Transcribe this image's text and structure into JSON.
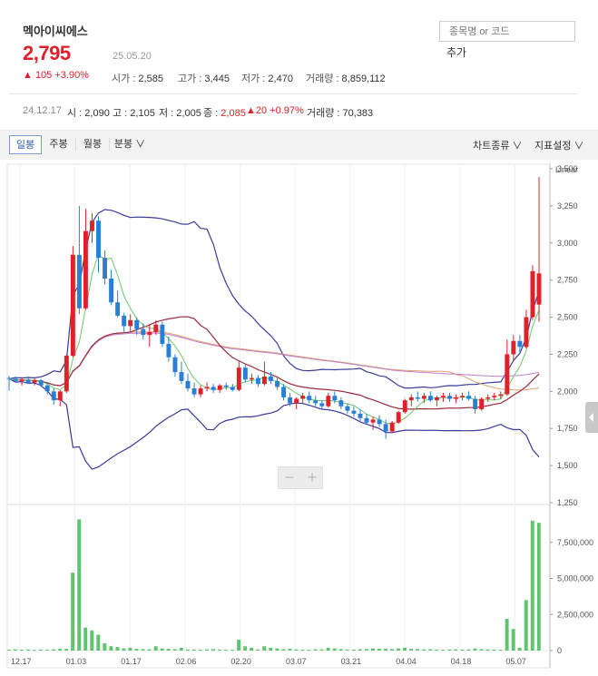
{
  "stock": {
    "name": "멕아이씨에스",
    "price": "2,795",
    "date": "25.05.20",
    "change": "▲ 105 +3.90%",
    "open_label": "시가 : ",
    "open": "2,585",
    "high_label": "고가 : ",
    "high": "3,445",
    "low_label": "저가 : ",
    "low": "2,470",
    "vol_label": "거래량 : ",
    "vol": "8,859,112"
  },
  "search": {
    "placeholder": "종목명 or 코드",
    "add_label": "추가"
  },
  "hover": {
    "date": "24.12.17",
    "open": "시 : 2,090",
    "high": "고 : 2,105",
    "low": "저 : 2,005",
    "close_label": "종 : ",
    "close": "2,085",
    "change": "▲20 +0.97%",
    "vol": "거래량 : 70,383"
  },
  "toolbar": {
    "tabs": [
      "일봉",
      "주봉",
      "월봉",
      "분봉 ∨"
    ],
    "chart_type": "차트종류 ∨",
    "indicator": "지표설정 ∨"
  },
  "colors": {
    "up": "#e0202a",
    "down": "#2a7fd4",
    "volume": "#5ec46e"
  },
  "chart_data": {
    "type": "candlestick",
    "scale_label": "Linear",
    "price_axis": {
      "min": 1250,
      "max": 3500,
      "ticks": [
        "3,500",
        "3,250",
        "3,000",
        "2,750",
        "2,500",
        "2,250",
        "2,000",
        "1,750",
        "1,500",
        "1,250"
      ]
    },
    "volume_axis": {
      "max": 10000000,
      "ticks": [
        "7,500,000",
        "5,000,000",
        "2,500,000",
        "0"
      ]
    },
    "x_ticks": [
      "12.17",
      "01.03",
      "01.17",
      "02.06",
      "02.20",
      "03.07",
      "03.21",
      "04.04",
      "04.18",
      "05.07"
    ],
    "candles_ohlc": [
      [
        2090,
        2105,
        2005,
        2085
      ],
      [
        2085,
        2100,
        2060,
        2070
      ],
      [
        2070,
        2095,
        2040,
        2080
      ],
      [
        2080,
        2100,
        2050,
        2060
      ],
      [
        2060,
        2090,
        2040,
        2075
      ],
      [
        2075,
        2085,
        2030,
        2040
      ],
      [
        2040,
        2060,
        1980,
        2000
      ],
      [
        2000,
        2020,
        1910,
        1940
      ],
      [
        1940,
        2010,
        1900,
        2000
      ],
      [
        2000,
        2250,
        1990,
        2240
      ],
      [
        2240,
        2980,
        2230,
        2920
      ],
      [
        2920,
        3250,
        2520,
        2560
      ],
      [
        2560,
        3230,
        2550,
        3080
      ],
      [
        3080,
        3200,
        3000,
        3150
      ],
      [
        3150,
        3180,
        2800,
        2900
      ],
      [
        2900,
        2950,
        2720,
        2760
      ],
      [
        2760,
        2820,
        2580,
        2600
      ],
      [
        2600,
        2680,
        2500,
        2510
      ],
      [
        2510,
        2530,
        2400,
        2440
      ],
      [
        2440,
        2520,
        2400,
        2480
      ],
      [
        2480,
        2500,
        2380,
        2420
      ],
      [
        2420,
        2460,
        2350,
        2380
      ],
      [
        2380,
        2450,
        2300,
        2400
      ],
      [
        2400,
        2480,
        2380,
        2450
      ],
      [
        2450,
        2470,
        2300,
        2320
      ],
      [
        2320,
        2370,
        2200,
        2230
      ],
      [
        2230,
        2250,
        2100,
        2130
      ],
      [
        2130,
        2200,
        2050,
        2070
      ],
      [
        2070,
        2120,
        2000,
        2020
      ],
      [
        2020,
        2060,
        1960,
        1980
      ],
      [
        1980,
        2040,
        1960,
        2020
      ],
      [
        2020,
        2060,
        2000,
        2030
      ],
      [
        2030,
        2050,
        1990,
        2010
      ],
      [
        2010,
        2050,
        1990,
        2040
      ],
      [
        2040,
        2060,
        2010,
        2030
      ],
      [
        2030,
        2050,
        2000,
        2010
      ],
      [
        2010,
        2200,
        2000,
        2160
      ],
      [
        2160,
        2180,
        2060,
        2080
      ],
      [
        2080,
        2120,
        2050,
        2090
      ],
      [
        2090,
        2110,
        2030,
        2050
      ],
      [
        2050,
        2200,
        2040,
        2100
      ],
      [
        2100,
        2130,
        2050,
        2070
      ],
      [
        2070,
        2090,
        2010,
        2030
      ],
      [
        2030,
        2050,
        1940,
        1960
      ],
      [
        1960,
        1990,
        1900,
        1920
      ],
      [
        1920,
        1960,
        1880,
        1950
      ],
      [
        1950,
        1990,
        1920,
        1970
      ],
      [
        1970,
        2000,
        1920,
        1940
      ],
      [
        1940,
        1970,
        1900,
        1920
      ],
      [
        1920,
        1940,
        1880,
        1900
      ],
      [
        1900,
        1990,
        1890,
        1970
      ],
      [
        1970,
        2000,
        1920,
        1940
      ],
      [
        1940,
        1960,
        1880,
        1900
      ],
      [
        1900,
        1920,
        1850,
        1870
      ],
      [
        1870,
        1900,
        1830,
        1850
      ],
      [
        1850,
        1880,
        1800,
        1820
      ],
      [
        1820,
        1850,
        1780,
        1790
      ],
      [
        1790,
        1830,
        1740,
        1810
      ],
      [
        1810,
        1840,
        1760,
        1780
      ],
      [
        1780,
        1810,
        1680,
        1730
      ],
      [
        1730,
        1800,
        1720,
        1790
      ],
      [
        1790,
        1870,
        1780,
        1860
      ],
      [
        1860,
        1950,
        1850,
        1940
      ],
      [
        1940,
        1980,
        1900,
        1960
      ],
      [
        1960,
        2000,
        1930,
        1950
      ],
      [
        1950,
        1990,
        1920,
        1970
      ],
      [
        1970,
        2000,
        1930,
        1940
      ],
      [
        1940,
        1970,
        1900,
        1960
      ],
      [
        1960,
        1990,
        1930,
        1970
      ],
      [
        1970,
        1990,
        1930,
        1950
      ],
      [
        1950,
        1980,
        1920,
        1960
      ],
      [
        1960,
        1990,
        1940,
        1970
      ],
      [
        1970,
        2000,
        1940,
        1950
      ],
      [
        1950,
        1970,
        1850,
        1880
      ],
      [
        1880,
        1960,
        1870,
        1950
      ],
      [
        1950,
        1980,
        1930,
        1960
      ],
      [
        1960,
        1990,
        1940,
        1970
      ],
      [
        1970,
        2000,
        1950,
        1980
      ],
      [
        1980,
        2350,
        1970,
        2250
      ],
      [
        2250,
        2380,
        2200,
        2340
      ],
      [
        2340,
        2380,
        2260,
        2300
      ],
      [
        2300,
        2550,
        2290,
        2500
      ],
      [
        2500,
        2850,
        2480,
        2810
      ],
      [
        2585,
        3445,
        2470,
        2795
      ]
    ],
    "volume_shares": [
      70000,
      90000,
      60000,
      80000,
      50000,
      70000,
      60000,
      90000,
      120000,
      120000,
      5400000,
      9100000,
      1600000,
      1400000,
      1100000,
      500000,
      300000,
      250000,
      150000,
      200000,
      120000,
      100000,
      90000,
      300000,
      150000,
      120000,
      100000,
      200000,
      80000,
      70000,
      60000,
      80000,
      100000,
      70000,
      60000,
      50000,
      750000,
      300000,
      200000,
      80000,
      300000,
      200000,
      150000,
      100000,
      120000,
      80000,
      70000,
      60000,
      90000,
      80000,
      200000,
      150000,
      100000,
      80000,
      70000,
      90000,
      100000,
      150000,
      130000,
      120000,
      100000,
      150000,
      200000,
      120000,
      100000,
      80000,
      90000,
      70000,
      60000,
      80000,
      90000,
      70000,
      80000,
      150000,
      100000,
      80000,
      70000,
      60000,
      2200000,
      1500000,
      200000,
      3500000,
      9000000,
      8859112
    ]
  }
}
